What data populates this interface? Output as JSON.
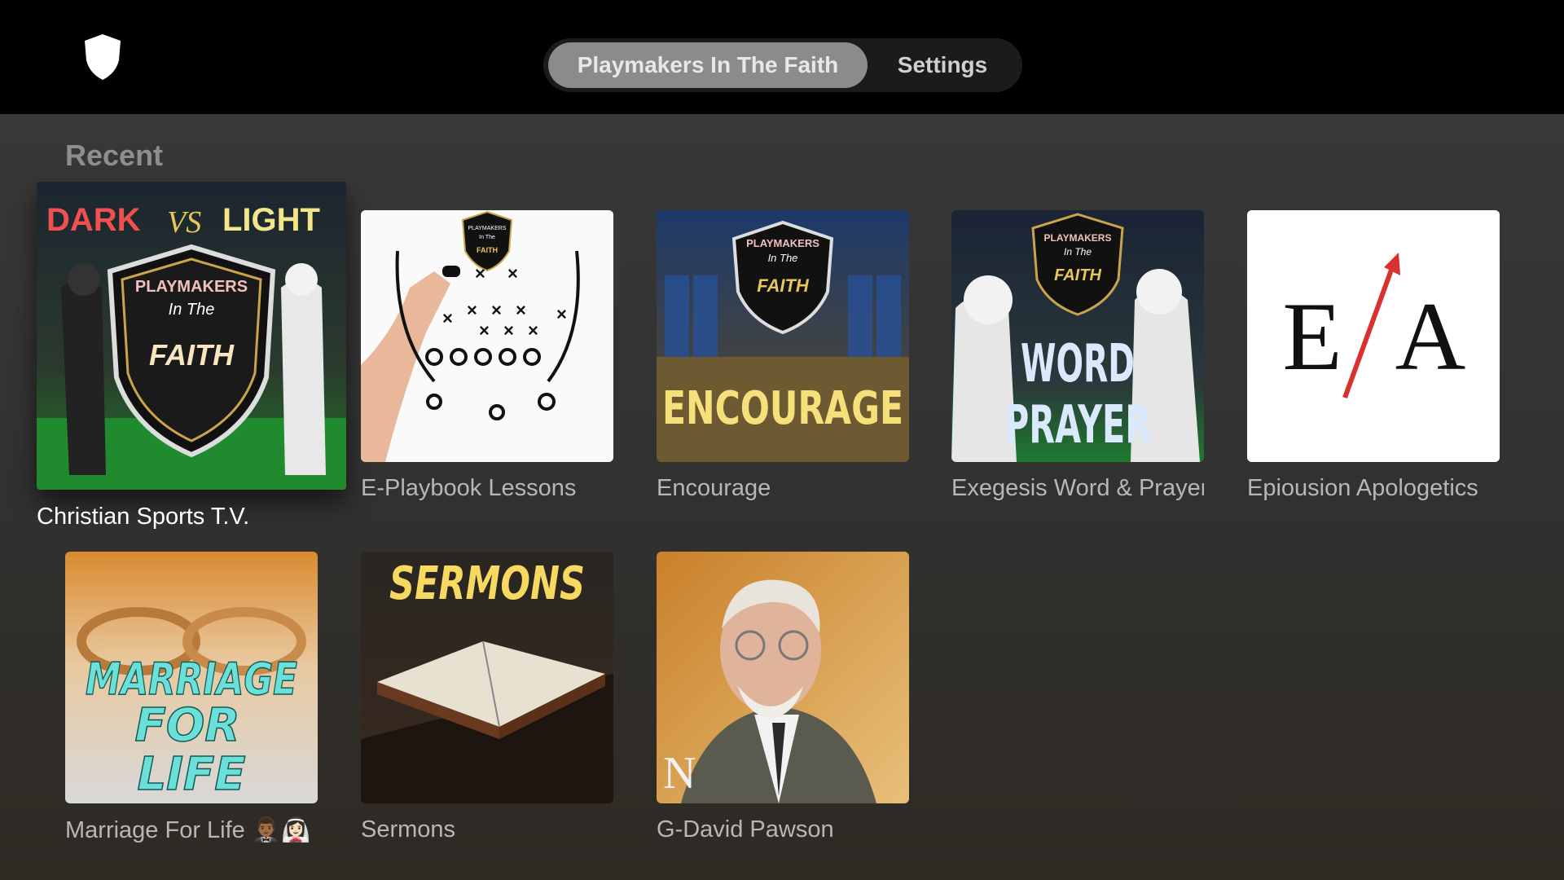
{
  "nav": {
    "tabs": [
      {
        "label": "Playmakers In The Faith",
        "active": true
      },
      {
        "label": "Settings",
        "active": false
      }
    ]
  },
  "recent": {
    "title": "Recent",
    "items": [
      {
        "label": "Christian Sports T.V.",
        "art_text": [
          "DARK",
          "VS",
          "LIGHT",
          "PLAYMAKERS",
          "In The",
          "FAITH"
        ],
        "focused": true
      },
      {
        "label": "E-Playbook Lessons",
        "art_text": [
          "PLAYMAKERS",
          "In The",
          "FAITH"
        ]
      },
      {
        "label": "Encourage",
        "art_text": [
          "PLAYMAKERS",
          "In The",
          "FAITH",
          "ENCOURAGE"
        ]
      },
      {
        "label": "Exegesis Word & Prayer",
        "art_text": [
          "PLAYMAKERS",
          "In The",
          "FAITH",
          "WORD",
          "PRAYER"
        ]
      },
      {
        "label": "Epiousion Apologetics",
        "art_text": [
          "E",
          "A"
        ]
      },
      {
        "label": "Marriage For Life 🤵🏾‍♂️👰🏻‍♀️",
        "art_text": [
          "MARRIAGE",
          "FOR",
          "LIFE"
        ]
      },
      {
        "label": "Sermons",
        "art_text": [
          "SERMONS"
        ]
      },
      {
        "label": "G-David Pawson",
        "art_text": [
          "N"
        ]
      }
    ]
  },
  "colors": {
    "background": "#333333",
    "topbar": "#000000",
    "tab_active": "#8b8b8b",
    "gold": "#e8c65a",
    "accent_red": "#d93030"
  }
}
